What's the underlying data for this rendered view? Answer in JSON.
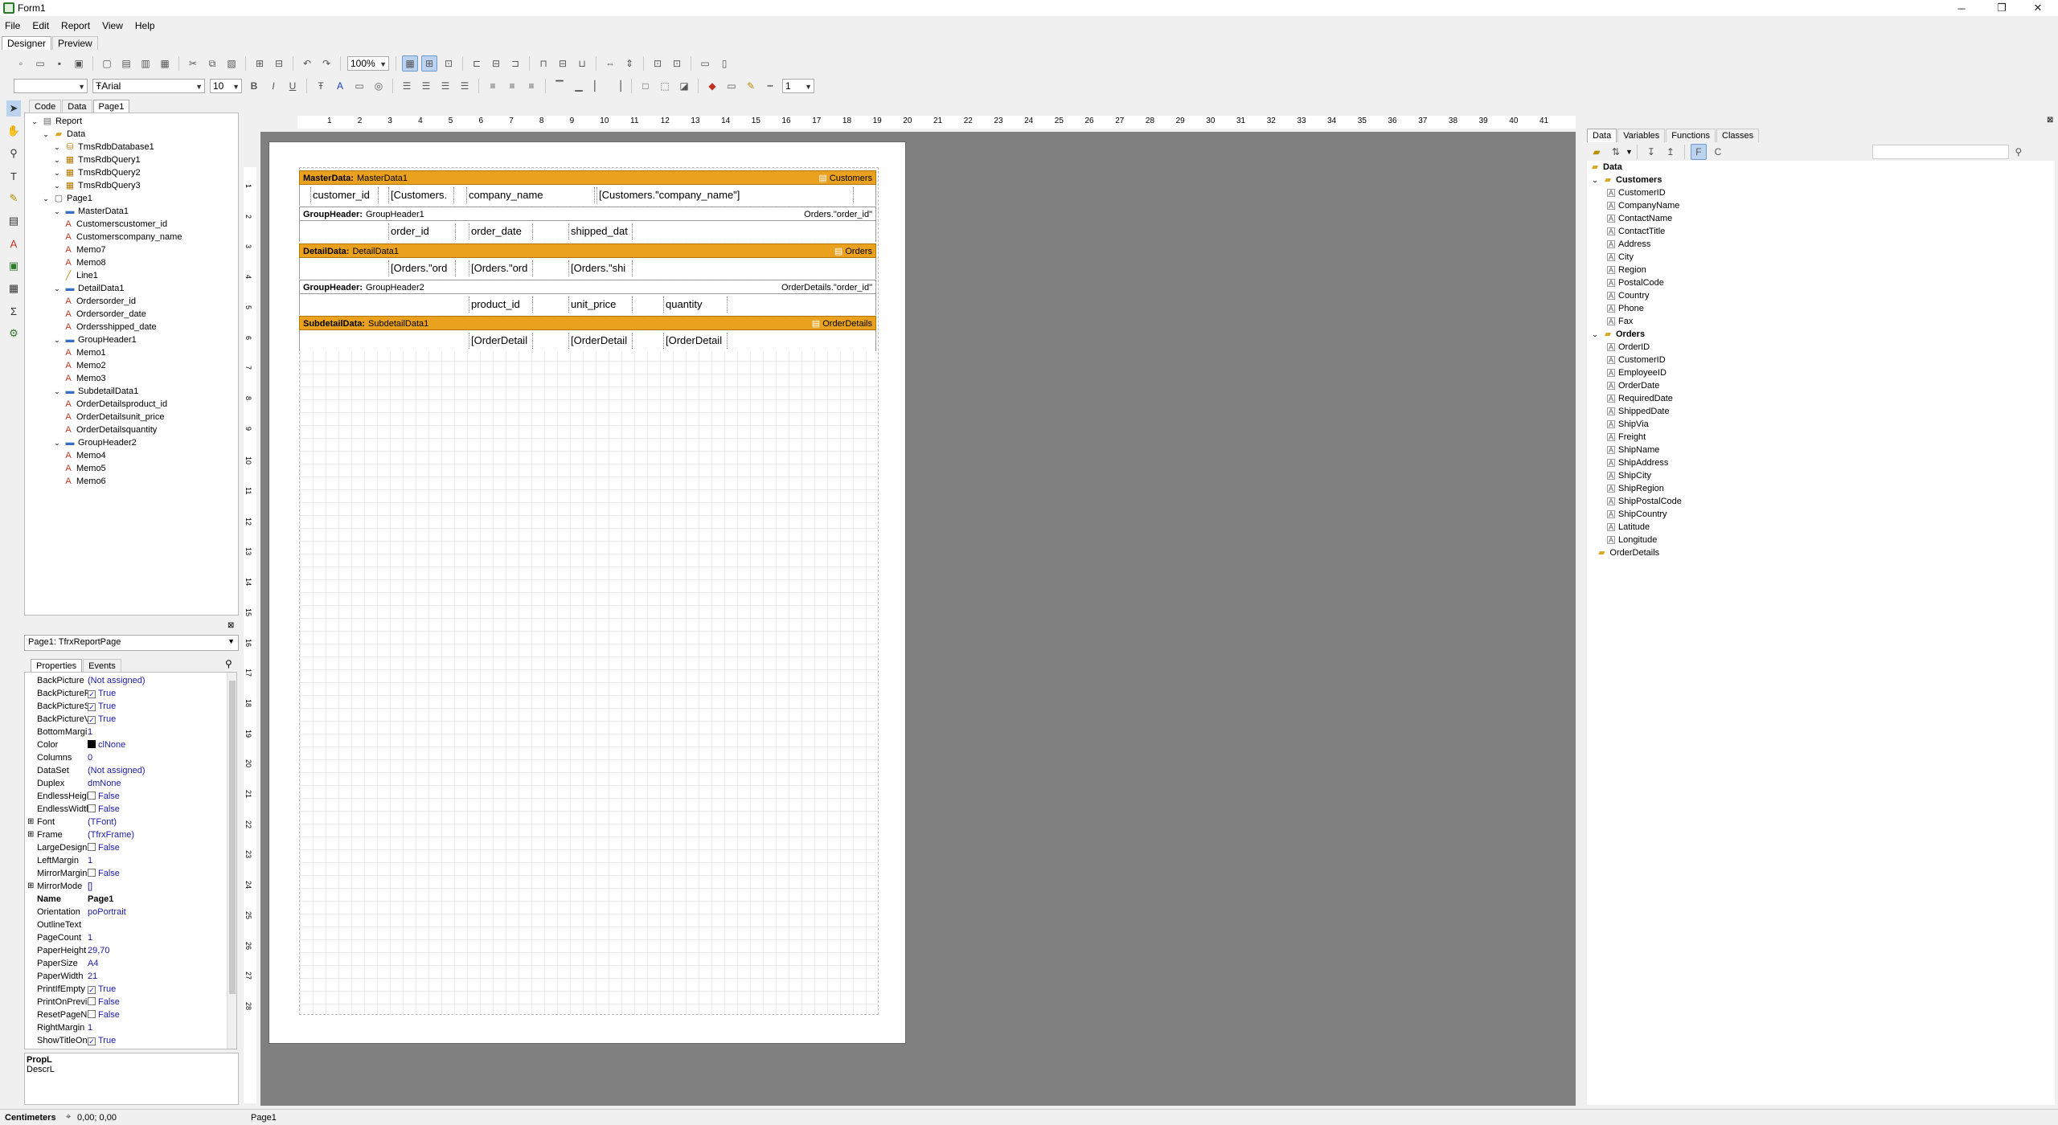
{
  "window": {
    "title": "Form1",
    "controls": [
      "─",
      "❐",
      "✕"
    ]
  },
  "menu": [
    "File",
    "Edit",
    "Report",
    "View",
    "Help"
  ],
  "main_tabs": [
    "Designer",
    "Preview"
  ],
  "toolbar2": {
    "style_combo": "",
    "font_name": "Arial",
    "font_size": "10",
    "line_width": "1"
  },
  "toolbar1": {
    "zoom": "100%"
  },
  "designer_tabs": [
    "Code",
    "Data",
    "Page1"
  ],
  "tree": [
    {
      "label": "Report",
      "level": 0,
      "icon": "report-icon"
    },
    {
      "label": "Data",
      "level": 1,
      "icon": "folder-icon"
    },
    {
      "label": "TmsRdbDatabase1",
      "level": 2,
      "icon": "database-icon"
    },
    {
      "label": "TmsRdbQuery1",
      "level": 2,
      "icon": "query-icon"
    },
    {
      "label": "TmsRdbQuery2",
      "level": 2,
      "icon": "query-icon"
    },
    {
      "label": "TmsRdbQuery3",
      "level": 2,
      "icon": "query-icon"
    },
    {
      "label": "Page1",
      "level": 1,
      "icon": "page-icon"
    },
    {
      "label": "MasterData1",
      "level": 2,
      "icon": "band-icon"
    },
    {
      "label": "Customerscustomer_id",
      "level": 3,
      "icon": "text-icon"
    },
    {
      "label": "Customerscompany_name",
      "level": 3,
      "icon": "text-icon"
    },
    {
      "label": "Memo7",
      "level": 3,
      "icon": "text-icon"
    },
    {
      "label": "Memo8",
      "level": 3,
      "icon": "text-icon"
    },
    {
      "label": "Line1",
      "level": 3,
      "icon": "line-icon"
    },
    {
      "label": "DetailData1",
      "level": 2,
      "icon": "band-icon"
    },
    {
      "label": "Ordersorder_id",
      "level": 3,
      "icon": "text-icon"
    },
    {
      "label": "Ordersorder_date",
      "level": 3,
      "icon": "text-icon"
    },
    {
      "label": "Ordersshipped_date",
      "level": 3,
      "icon": "text-icon"
    },
    {
      "label": "GroupHeader1",
      "level": 2,
      "icon": "band-icon"
    },
    {
      "label": "Memo1",
      "level": 3,
      "icon": "text-icon"
    },
    {
      "label": "Memo2",
      "level": 3,
      "icon": "text-icon"
    },
    {
      "label": "Memo3",
      "level": 3,
      "icon": "text-icon"
    },
    {
      "label": "SubdetailData1",
      "level": 2,
      "icon": "band-icon"
    },
    {
      "label": "OrderDetailsproduct_id",
      "level": 3,
      "icon": "text-icon"
    },
    {
      "label": "OrderDetailsunit_price",
      "level": 3,
      "icon": "text-icon"
    },
    {
      "label": "OrderDetailsquantity",
      "level": 3,
      "icon": "text-icon"
    },
    {
      "label": "GroupHeader2",
      "level": 2,
      "icon": "band-icon"
    },
    {
      "label": "Memo4",
      "level": 3,
      "icon": "text-icon"
    },
    {
      "label": "Memo5",
      "level": 3,
      "icon": "text-icon"
    },
    {
      "label": "Memo6",
      "level": 3,
      "icon": "text-icon"
    }
  ],
  "object_combo": "Page1: TfrxReportPage",
  "inspector_tabs": [
    "Properties",
    "Events"
  ],
  "properties": [
    {
      "k": "BackPicture",
      "v": "(Not assigned)"
    },
    {
      "k": "BackPicturePr",
      "v": "True",
      "chk": true
    },
    {
      "k": "BackPictureSt",
      "v": "True",
      "chk": true
    },
    {
      "k": "BackPictureVi",
      "v": "True",
      "chk": true
    },
    {
      "k": "BottomMargin",
      "v": "1"
    },
    {
      "k": "Color",
      "v": "clNone",
      "swatch": true
    },
    {
      "k": "Columns",
      "v": "0"
    },
    {
      "k": "DataSet",
      "v": "(Not assigned)"
    },
    {
      "k": "Duplex",
      "v": "dmNone"
    },
    {
      "k": "EndlessHeight",
      "v": "False",
      "chk": false
    },
    {
      "k": "EndlessWidth",
      "v": "False",
      "chk": false
    },
    {
      "k": "Font",
      "v": "(TFont)",
      "exp": true
    },
    {
      "k": "Frame",
      "v": "(TfrxFrame)",
      "exp": true
    },
    {
      "k": "LargeDesignH",
      "v": "False",
      "chk": false
    },
    {
      "k": "LeftMargin",
      "v": "1"
    },
    {
      "k": "MirrorMargins",
      "v": "False",
      "chk": false
    },
    {
      "k": "MirrorMode",
      "v": "[]",
      "exp": true
    },
    {
      "k": "Name",
      "v": "Page1",
      "bold": true
    },
    {
      "k": "Orientation",
      "v": "poPortrait"
    },
    {
      "k": "OutlineText",
      "v": ""
    },
    {
      "k": "PageCount",
      "v": "1"
    },
    {
      "k": "PaperHeight",
      "v": "29,70"
    },
    {
      "k": "PaperSize",
      "v": "A4"
    },
    {
      "k": "PaperWidth",
      "v": "21"
    },
    {
      "k": "PrintIfEmpty",
      "v": "True",
      "chk": true
    },
    {
      "k": "PrintOnPrevio",
      "v": "False",
      "chk": false
    },
    {
      "k": "ResetPageNu",
      "v": "False",
      "chk": false
    },
    {
      "k": "RightMargin",
      "v": "1"
    },
    {
      "k": "ShowTitleOnl",
      "v": "True",
      "chk": true
    }
  ],
  "desc": {
    "title": "PropL",
    "text": "DescrL"
  },
  "status": {
    "units": "Centimeters",
    "coords": "0,00; 0,00",
    "page": "Page1"
  },
  "ruler_h": [
    "1",
    "2",
    "3",
    "4",
    "5",
    "6",
    "7",
    "8",
    "9",
    "10",
    "11",
    "12",
    "13",
    "14",
    "15",
    "16",
    "17",
    "18",
    "19",
    "20",
    "21",
    "22",
    "23",
    "24",
    "25",
    "26",
    "27",
    "28",
    "29",
    "30",
    "31",
    "32",
    "33",
    "34",
    "35",
    "36",
    "37",
    "38",
    "39",
    "40",
    "41"
  ],
  "ruler_v": [
    "1",
    "2",
    "3",
    "4",
    "5",
    "6",
    "7",
    "8",
    "9",
    "10",
    "11",
    "12",
    "13",
    "14",
    "15",
    "16",
    "17",
    "18",
    "19",
    "20",
    "21",
    "22",
    "23",
    "24",
    "25",
    "26",
    "27",
    "28"
  ],
  "bands": [
    {
      "kind": "MasterData:",
      "name": "MasterData1",
      "right": "Customers",
      "type": "data",
      "memos": [
        "customer_id",
        "[Customers.",
        "company_name",
        "[Customers.\"company_name\"]"
      ]
    },
    {
      "kind": "GroupHeader:",
      "name": "GroupHeader1",
      "right": "Orders.\"order_id\"",
      "type": "group",
      "memos": [
        "order_id",
        "order_date",
        "shipped_dat"
      ]
    },
    {
      "kind": "DetailData:",
      "name": "DetailData1",
      "right": "Orders",
      "type": "data",
      "memos": [
        "[Orders.\"ord",
        "[Orders.\"ord",
        "[Orders.\"shi"
      ]
    },
    {
      "kind": "GroupHeader:",
      "name": "GroupHeader2",
      "right": "OrderDetails.\"order_id\"",
      "type": "group",
      "memos": [
        "product_id",
        "unit_price",
        "quantity"
      ]
    },
    {
      "kind": "SubdetailData:",
      "name": "SubdetailData1",
      "right": "OrderDetails",
      "type": "data",
      "memos": [
        "[OrderDetail",
        "[OrderDetail",
        "[OrderDetail"
      ]
    }
  ],
  "right_tabs": [
    "Data",
    "Variables",
    "Functions",
    "Classes"
  ],
  "data_tree": {
    "root": "Data",
    "groups": [
      {
        "name": "Customers",
        "fields": [
          "CustomerID",
          "CompanyName",
          "ContactName",
          "ContactTitle",
          "Address",
          "City",
          "Region",
          "PostalCode",
          "Country",
          "Phone",
          "Fax"
        ]
      },
      {
        "name": "Orders",
        "fields": [
          "OrderID",
          "CustomerID",
          "EmployeeID",
          "OrderDate",
          "RequiredDate",
          "ShippedDate",
          "ShipVia",
          "Freight",
          "ShipName",
          "ShipAddress",
          "ShipCity",
          "ShipRegion",
          "ShipPostalCode",
          "ShipCountry",
          "Latitude",
          "Longitude"
        ]
      }
    ],
    "extra": "OrderDetails"
  },
  "colors": {
    "band_orange": "#e9a11e",
    "workspace": "#808080",
    "selection": "#bcd3f0"
  }
}
